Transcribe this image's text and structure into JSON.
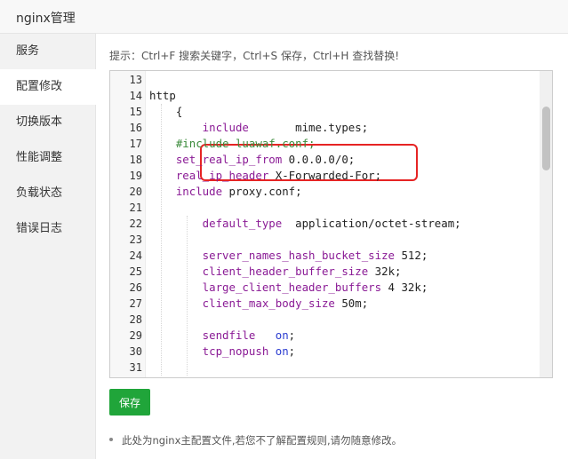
{
  "window": {
    "title": "nginx管理"
  },
  "sidebar": {
    "items": [
      {
        "label": "服务"
      },
      {
        "label": "配置修改"
      },
      {
        "label": "切换版本"
      },
      {
        "label": "性能调整"
      },
      {
        "label": "负载状态"
      },
      {
        "label": "错误日志"
      }
    ],
    "active_index": 1
  },
  "editor": {
    "hint": "提示：Ctrl+F 搜索关键字，Ctrl+S 保存，Ctrl+H 查找替换!",
    "lines": [
      {
        "n": "13",
        "parts": []
      },
      {
        "n": "14",
        "parts": [
          {
            "t": "http",
            "c": "val"
          }
        ]
      },
      {
        "n": "15",
        "parts": [
          {
            "t": "    {",
            "c": "val"
          }
        ]
      },
      {
        "n": "16",
        "parts": [
          {
            "t": "        include",
            "c": "kw"
          },
          {
            "t": "       mime.types;",
            "c": "val"
          }
        ]
      },
      {
        "n": "17",
        "parts": [
          {
            "t": "    #include luawaf.conf;",
            "c": "cm"
          }
        ]
      },
      {
        "n": "18",
        "parts": [
          {
            "t": "    set_real_ip_from",
            "c": "kw"
          },
          {
            "t": " 0.0.0.0/0;",
            "c": "val"
          }
        ]
      },
      {
        "n": "19",
        "parts": [
          {
            "t": "    real_ip_header",
            "c": "kw"
          },
          {
            "t": " X-Forwarded-For;",
            "c": "val"
          }
        ]
      },
      {
        "n": "20",
        "parts": [
          {
            "t": "    include",
            "c": "kw"
          },
          {
            "t": " proxy.conf;",
            "c": "val"
          }
        ]
      },
      {
        "n": "21",
        "parts": []
      },
      {
        "n": "22",
        "parts": [
          {
            "t": "        default_type",
            "c": "kw"
          },
          {
            "t": "  application/octet-stream;",
            "c": "val"
          }
        ]
      },
      {
        "n": "23",
        "parts": []
      },
      {
        "n": "24",
        "parts": [
          {
            "t": "        server_names_hash_bucket_size",
            "c": "kw"
          },
          {
            "t": " 512;",
            "c": "val"
          }
        ]
      },
      {
        "n": "25",
        "parts": [
          {
            "t": "        client_header_buffer_size",
            "c": "kw"
          },
          {
            "t": " 32k;",
            "c": "val"
          }
        ]
      },
      {
        "n": "26",
        "parts": [
          {
            "t": "        large_client_header_buffers",
            "c": "kw"
          },
          {
            "t": " 4 32k;",
            "c": "val"
          }
        ]
      },
      {
        "n": "27",
        "parts": [
          {
            "t": "        client_max_body_size",
            "c": "kw"
          },
          {
            "t": " 50m;",
            "c": "val"
          }
        ]
      },
      {
        "n": "28",
        "parts": []
      },
      {
        "n": "29",
        "parts": [
          {
            "t": "        sendfile",
            "c": "kw"
          },
          {
            "t": "   ",
            "c": "val"
          },
          {
            "t": "on",
            "c": "bl"
          },
          {
            "t": ";",
            "c": "val"
          }
        ]
      },
      {
        "n": "30",
        "parts": [
          {
            "t": "        tcp_nopush",
            "c": "kw"
          },
          {
            "t": " ",
            "c": "val"
          },
          {
            "t": "on",
            "c": "bl"
          },
          {
            "t": ";",
            "c": "val"
          }
        ]
      },
      {
        "n": "31",
        "parts": []
      }
    ]
  },
  "actions": {
    "save_label": "保存"
  },
  "footer": {
    "note": "此处为nginx主配置文件,若您不了解配置规则,请勿随意修改。"
  },
  "colors": {
    "accent": "#20a53a",
    "highlight": "#e62424",
    "keyword": "#8a1a95",
    "comment": "#3a8a3a",
    "boolean": "#2a3bd0"
  }
}
